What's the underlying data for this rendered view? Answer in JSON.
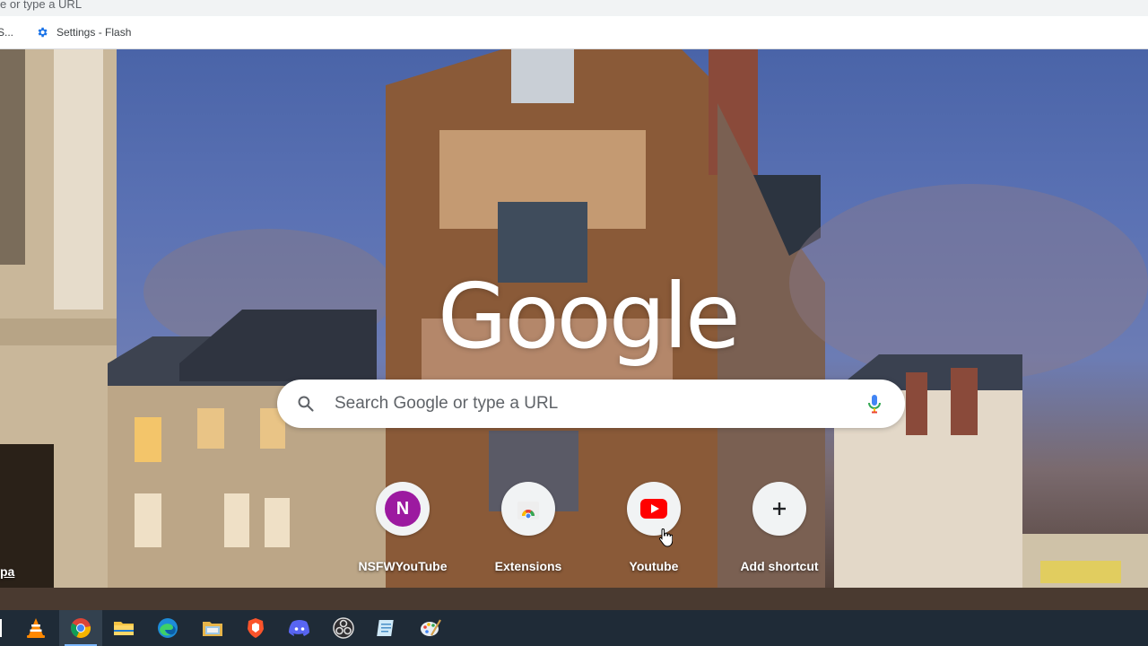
{
  "browser": {
    "omnibox_text": "e or type a URL",
    "bookmarks": [
      {
        "label": "S...",
        "icon": "bookmark-icon"
      },
      {
        "label": "Settings - Flash",
        "icon": "gear-icon"
      }
    ]
  },
  "ntp": {
    "logo_text": "Google",
    "search": {
      "placeholder": "Search Google or type a URL"
    },
    "shortcuts": [
      {
        "label": "NSFWYouTube",
        "avatar_letter": "N",
        "icon": "letter-avatar-icon"
      },
      {
        "label": "Extensions",
        "icon": "chrome-web-store-icon"
      },
      {
        "label": "Youtube",
        "icon": "youtube-icon"
      },
      {
        "label": "Add shortcut",
        "icon": "plus-icon"
      }
    ],
    "left_fragment": "pa"
  },
  "taskbar": {
    "apps": [
      "vlc-icon",
      "chrome-icon",
      "file-explorer-icon",
      "edge-icon",
      "file-manager-icon",
      "brave-icon",
      "discord-icon",
      "obs-icon",
      "notepad-icon",
      "paint-icon"
    ],
    "active_app": "chrome-icon"
  },
  "colors": {
    "taskbar_bg": "#1f2b37",
    "avatar_purple": "#9c1aa0",
    "youtube_red": "#ff0000",
    "google_blue": "#1a73e8"
  }
}
